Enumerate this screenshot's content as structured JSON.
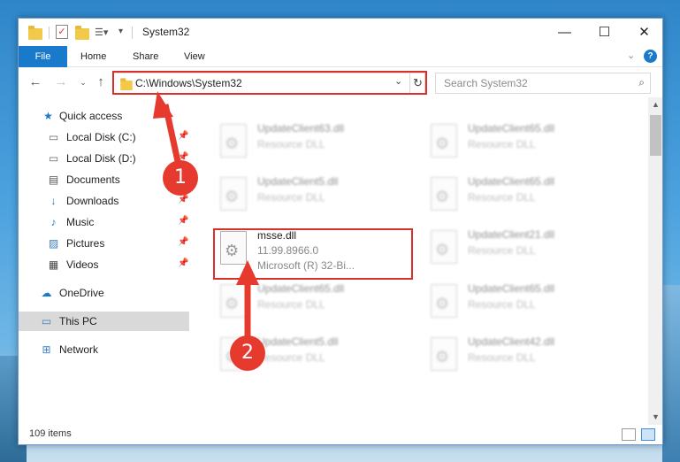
{
  "window": {
    "title": "System32",
    "controls": {
      "minimize": "—",
      "maximize": "☐",
      "close": "✕"
    }
  },
  "ribbon": {
    "tabs": [
      "File",
      "Home",
      "Share",
      "View"
    ],
    "expand_icon": "chevron-down-icon",
    "help": "?"
  },
  "address_bar": {
    "path": "C:\\Windows\\System32",
    "search_placeholder": "Search System32"
  },
  "sidebar": {
    "items": [
      {
        "label": "Quick access",
        "icon": "star-icon",
        "pinned": false
      },
      {
        "label": "Local Disk (C:)",
        "icon": "drive-icon",
        "pinned": true
      },
      {
        "label": "Local Disk (D:)",
        "icon": "drive-icon",
        "pinned": true
      },
      {
        "label": "Documents",
        "icon": "documents-icon",
        "pinned": true
      },
      {
        "label": "Downloads",
        "icon": "download-icon",
        "pinned": true
      },
      {
        "label": "Music",
        "icon": "music-icon",
        "pinned": true
      },
      {
        "label": "Pictures",
        "icon": "pictures-icon",
        "pinned": true
      },
      {
        "label": "Videos",
        "icon": "videos-icon",
        "pinned": true
      },
      {
        "label": "OneDrive",
        "icon": "cloud-icon",
        "pinned": false
      },
      {
        "label": "This PC",
        "icon": "computer-icon",
        "pinned": false,
        "selected": true
      },
      {
        "label": "Network",
        "icon": "network-icon",
        "pinned": false
      }
    ]
  },
  "files": {
    "left": [
      {
        "name": "UpdateClient63.dll",
        "type": "Resource DLL",
        "blurred": true
      },
      {
        "name": "UpdateClient5.dll",
        "type": "Resource DLL",
        "blurred": true
      },
      {
        "name": "msse.dll",
        "version": "11.99.8966.0",
        "type": "Microsoft (R) 32-Bi...",
        "blurred": false,
        "highlighted": true
      },
      {
        "name": "UpdateClient65.dll",
        "type": "Resource DLL",
        "blurred": true
      },
      {
        "name": "UpdateClient5.dll",
        "type": "Resource DLL",
        "blurred": true
      }
    ],
    "right": [
      {
        "name": "UpdateClient65.dll",
        "type": "Resource DLL",
        "blurred": true
      },
      {
        "name": "UpdateClient65.dll",
        "type": "Resource DLL",
        "blurred": true
      },
      {
        "name": "UpdateClient21.dll",
        "type": "Resource DLL",
        "blurred": true
      },
      {
        "name": "UpdateClient65.dll",
        "type": "Resource DLL",
        "blurred": true
      },
      {
        "name": "UpdateClient42.dll",
        "type": "Resource DLL",
        "blurred": true
      }
    ]
  },
  "status": {
    "item_count": "109 items"
  },
  "annotations": {
    "step1": "1",
    "step2": "2",
    "color": "#e63a2f"
  },
  "colors": {
    "accent": "#1979ca",
    "highlight_border": "#d9302b"
  }
}
